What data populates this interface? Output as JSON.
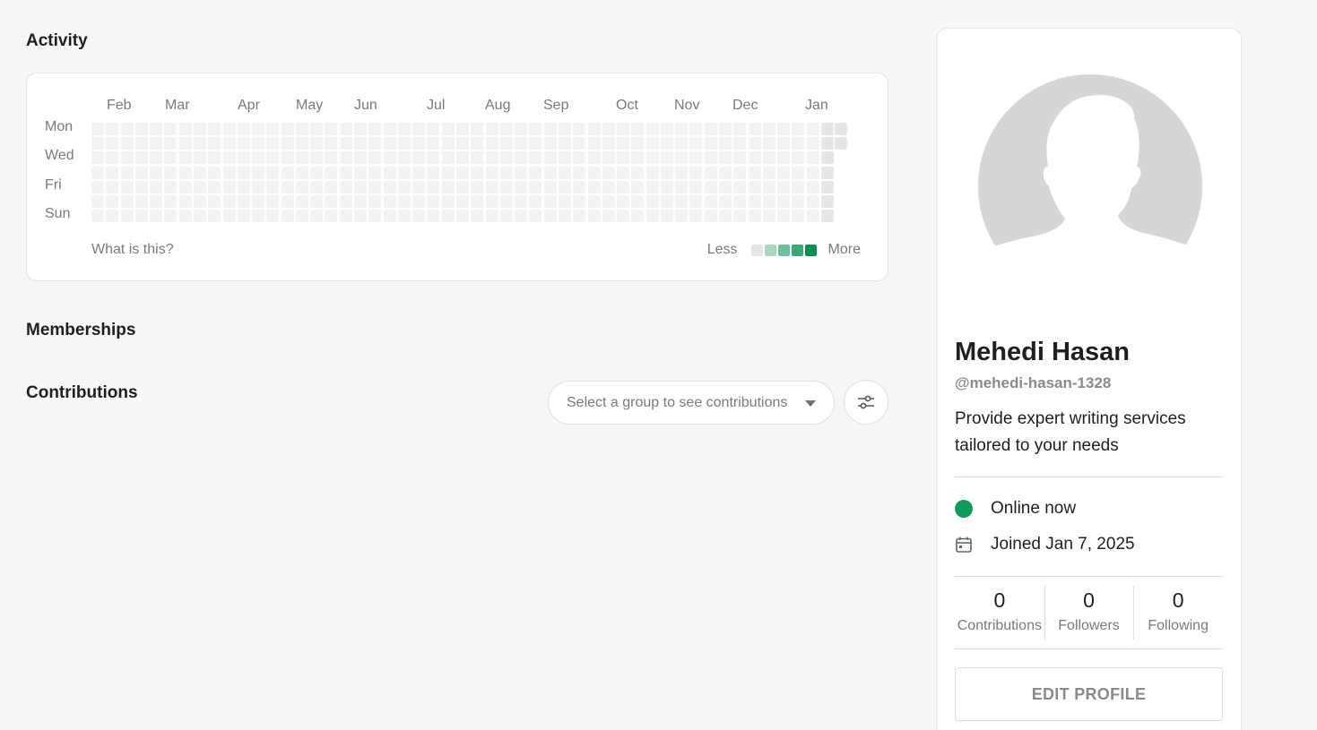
{
  "sections": {
    "activity_title": "Activity",
    "memberships_title": "Memberships",
    "contributions_title": "Contributions"
  },
  "activity": {
    "months": [
      "Feb",
      "Mar",
      "Apr",
      "May",
      "Jun",
      "Jul",
      "Aug",
      "Sep",
      "Oct",
      "Nov",
      "Dec",
      "Jan"
    ],
    "day_labels": [
      "Mon",
      "Wed",
      "Fri",
      "Sun"
    ],
    "help_link": "What is this?",
    "legend_less": "Less",
    "legend_more": "More",
    "legend_colors": [
      "#e5e5e5",
      "#a8d9c0",
      "#6ec29a",
      "#3aa876",
      "#0e8f55"
    ],
    "cell_color_empty": "#f3f3f3",
    "cell_color_latest": "#e6e6e6",
    "weeks": 51,
    "days_per_week": 7,
    "contribution_count": 0
  },
  "contributions": {
    "group_select_placeholder": "Select a group to see contributions",
    "filter_icon": "sliders-icon"
  },
  "profile": {
    "name": "Mehedi Hasan",
    "handle": "@mehedi-hasan-1328",
    "bio": "Provide expert writing services tailored to your needs",
    "online_status": "Online now",
    "online_color": "#0e9a5a",
    "joined": "Joined Jan 7, 2025",
    "stats": [
      {
        "value": "0",
        "label": "Contributions"
      },
      {
        "value": "0",
        "label": "Followers"
      },
      {
        "value": "0",
        "label": "Following"
      }
    ],
    "edit_button": "EDIT PROFILE"
  }
}
